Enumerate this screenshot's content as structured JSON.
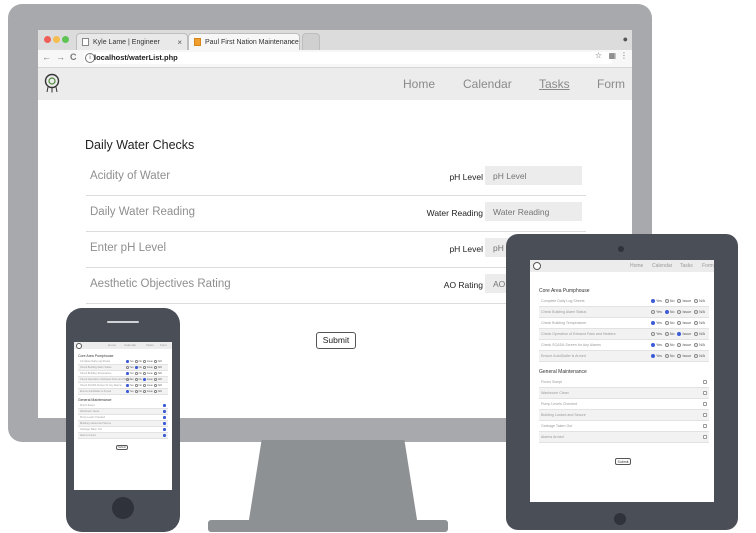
{
  "browser": {
    "tabs": [
      {
        "label": "Kyle Lame | Engineer",
        "close": "×"
      },
      {
        "label": "Paul First Nation Maintenance",
        "close": "×"
      }
    ],
    "url": "localhost/waterList.php",
    "back_icon": "←",
    "forward_icon": "→",
    "reload_icon": "C",
    "info_icon": "i",
    "star_icon": "☆",
    "ext_icon": "▦",
    "menu_icon": "⋮",
    "profile_icon": "●"
  },
  "site": {
    "nav": [
      "Home",
      "Calendar",
      "Tasks",
      "Form"
    ],
    "active_nav": "Tasks",
    "heading": "Daily Water Checks",
    "checks": [
      {
        "title": "Acidity of Water",
        "label": "pH Level",
        "placeholder": "pH Level"
      },
      {
        "title": "Daily Water Reading",
        "label": "Water Reading",
        "placeholder": "Water Reading"
      },
      {
        "title": "Enter pH Level",
        "label": "pH Level",
        "placeholder": "pH Level"
      },
      {
        "title": "Aesthetic Objectives Rating",
        "label": "AO Rating",
        "placeholder": "AO Rating"
      }
    ],
    "submit": "Submit"
  },
  "mobile": {
    "nav": [
      "Home",
      "Calendar",
      "Tasks",
      "Form"
    ],
    "section1": "Core Area Pumphouse",
    "radio_tasks": [
      {
        "label": "Complete Daily Log Sheets",
        "selected": 0
      },
      {
        "label": "Check Building Alarm Status",
        "selected": 1
      },
      {
        "label": "Check Building Temperature",
        "selected": 0
      },
      {
        "label": "Check Operation of Exhaust Fans and Heaters",
        "selected": 2
      },
      {
        "label": "Check SCADA Screen for Any Alarms",
        "selected": 0
      },
      {
        "label": "Ensure AutoDialler is Armed",
        "selected": 0
      }
    ],
    "radio_options": [
      "Yes",
      "No",
      "Issue",
      "N/A"
    ],
    "section2": "General Maintenance",
    "check_tasks": [
      "Floors Swept",
      "Washroom Clean",
      "Pump Levels Checked",
      "Building Locked and Secure",
      "Garbage Taken Out",
      "Alarms Armed"
    ],
    "submit": "Submit"
  },
  "colors": {
    "monitor_bezel": "#a7a9ac",
    "device_body": "#4a4e57",
    "nav_bg": "#ececec",
    "radio_selected": "#3c5bd6"
  }
}
